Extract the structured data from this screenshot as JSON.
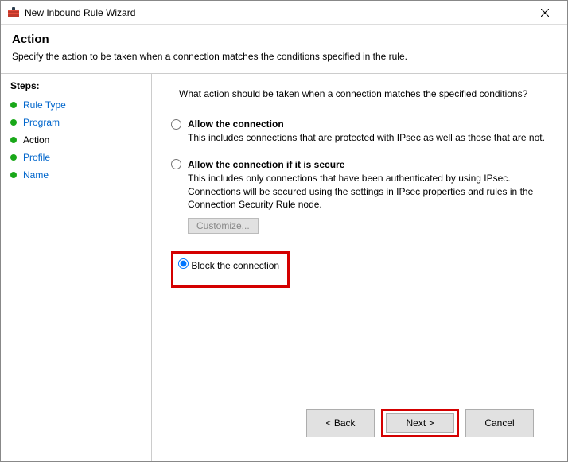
{
  "window": {
    "title": "New Inbound Rule Wizard"
  },
  "header": {
    "title": "Action",
    "subtitle": "Specify the action to be taken when a connection matches the conditions specified in the rule."
  },
  "sidebar": {
    "label": "Steps:",
    "items": [
      {
        "label": "Rule Type",
        "current": false
      },
      {
        "label": "Program",
        "current": false
      },
      {
        "label": "Action",
        "current": true
      },
      {
        "label": "Profile",
        "current": false
      },
      {
        "label": "Name",
        "current": false
      }
    ]
  },
  "content": {
    "question": "What action should be taken when a connection matches the specified conditions?",
    "options": {
      "allow": {
        "label": "Allow the connection",
        "desc": "This includes connections that are protected with IPsec as well as those that are not."
      },
      "secure": {
        "label": "Allow the connection if it is secure",
        "desc": "This includes only connections that have been authenticated by using IPsec. Connections will be secured using the settings in IPsec properties and rules in the Connection Security Rule node.",
        "customize": "Customize..."
      },
      "block": {
        "label": "Block the connection"
      }
    }
  },
  "footer": {
    "back": "< Back",
    "next": "Next >",
    "cancel": "Cancel"
  }
}
